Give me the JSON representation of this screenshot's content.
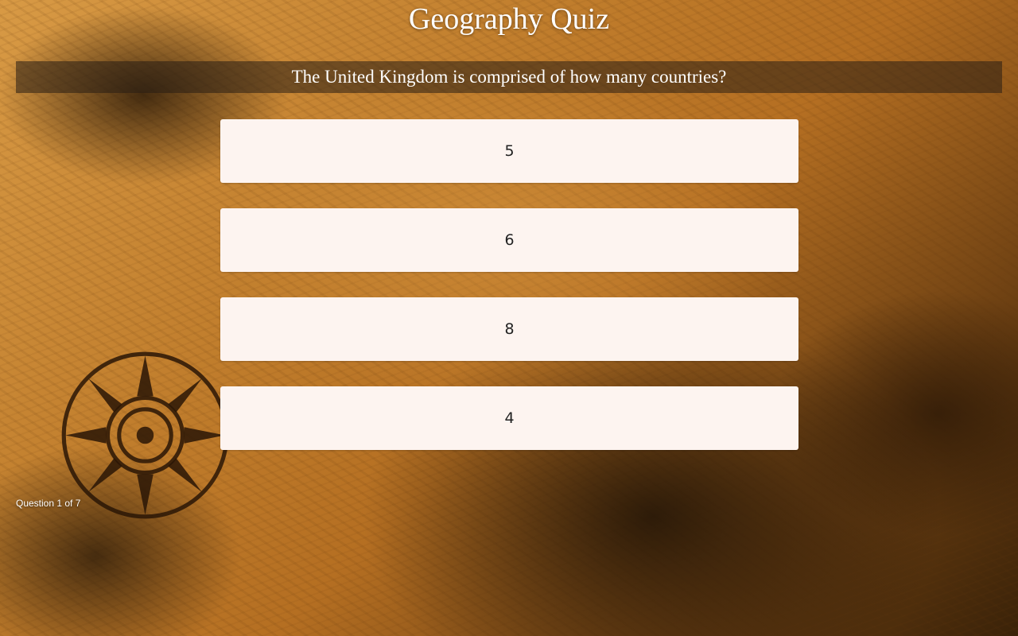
{
  "quiz": {
    "title": "Geography Quiz",
    "question": "The United Kingdom is comprised of how many countries?",
    "answers": [
      {
        "label": "5"
      },
      {
        "label": "6"
      },
      {
        "label": "8"
      },
      {
        "label": "4"
      }
    ],
    "progress": "Question 1 of 7"
  },
  "colors": {
    "answer_background": "#fdf4f0",
    "question_bar": "#281e14",
    "text": "#ffffff"
  },
  "background": {
    "image": "old-world-map-background",
    "decoration": "compass-rose-icon"
  }
}
